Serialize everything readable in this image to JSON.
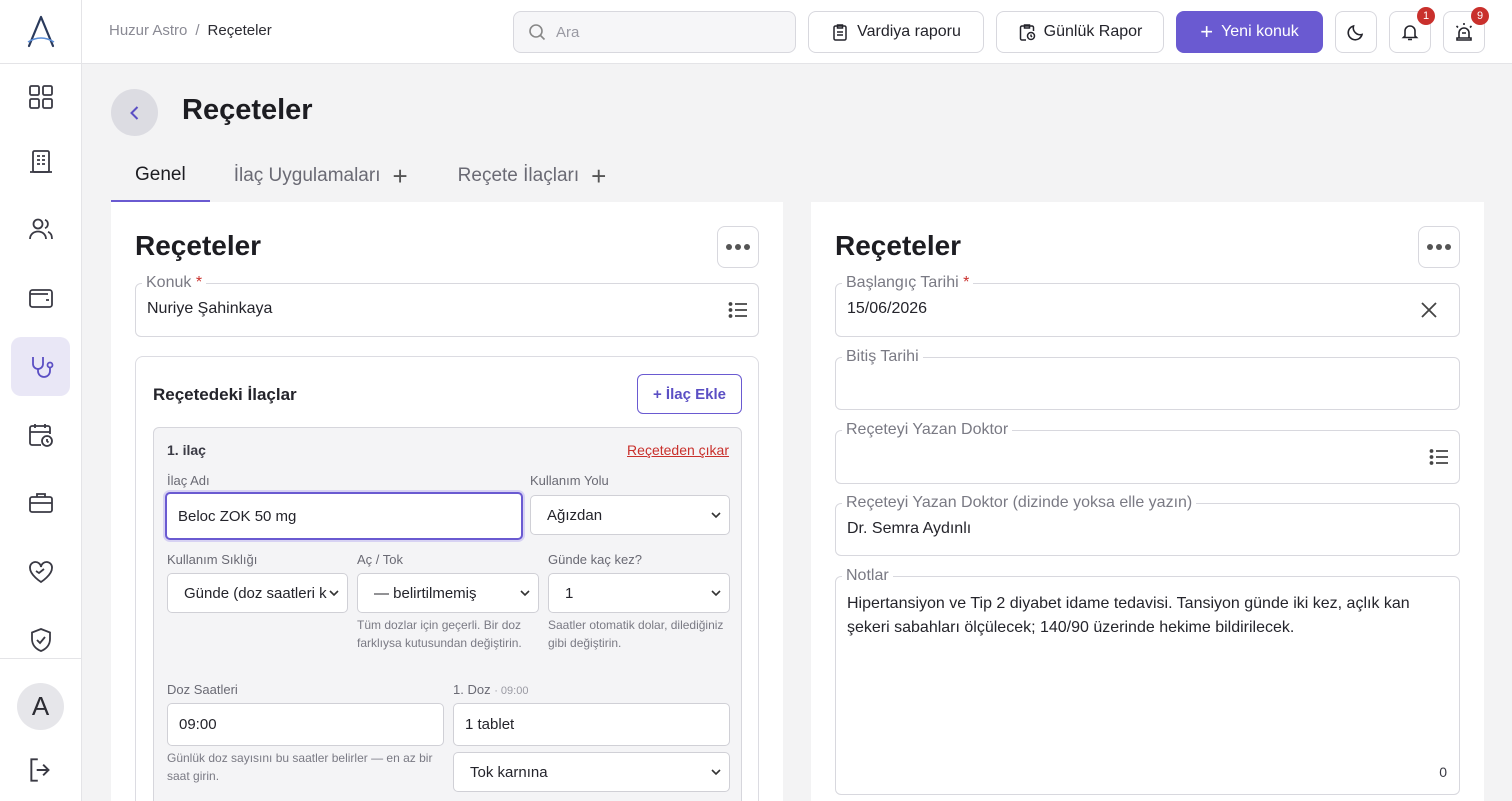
{
  "sidebar": {
    "logo_icon": "astro-logo-icon",
    "items": [
      {
        "name": "dashboard",
        "icon": "grid-icon"
      },
      {
        "name": "reports",
        "icon": "building-icon"
      },
      {
        "name": "guests",
        "icon": "users-icon"
      },
      {
        "name": "wallet",
        "icon": "wallet-icon"
      },
      {
        "name": "health",
        "icon": "stethoscope-icon",
        "active": true
      },
      {
        "name": "calendar",
        "icon": "calendar-clock-icon"
      },
      {
        "name": "staff",
        "icon": "briefcase-icon"
      },
      {
        "name": "care",
        "icon": "heart-hand-icon"
      },
      {
        "name": "security",
        "icon": "shield-check-icon"
      }
    ],
    "avatar_initial": "A"
  },
  "topbar": {
    "breadcrumb_root": "Huzur Astro",
    "breadcrumb_sep": "/",
    "breadcrumb_current": "Reçeteler",
    "search_placeholder": "Ara",
    "shift_report": "Vardiya raporu",
    "daily_report": "Günlük Rapor",
    "new_guest": "Yeni konuk",
    "notifications_count": "1",
    "alarm_count": "9"
  },
  "page": {
    "title": "Reçeteler",
    "tabs": [
      {
        "label": "Genel"
      },
      {
        "label": "İlaç Uygulamaları"
      },
      {
        "label": "Reçete İlaçları"
      }
    ]
  },
  "left_card": {
    "title": "Reçeteler",
    "guest_label": "Konuk",
    "required_mark": "*",
    "guest_value": "Nuriye Şahinkaya",
    "meds_title": "Reçetedeki İlaçlar",
    "add_med": "+ İlaç Ekle",
    "med": {
      "title": "1. ilaç",
      "remove": "Reçeteden çıkar",
      "name_label": "İlaç Adı",
      "name_value": "Beloc ZOK 50 mg",
      "route_label": "Kullanım Yolu",
      "route_value": "Ağızdan",
      "freq_label": "Kullanım Sıklığı",
      "freq_value": "Günde (doz saatleri k",
      "meal_label": "Aç / Tok",
      "meal_value": "— belirtilmemiş",
      "meal_help": "Tüm dozlar için geçerli. Bir doz farklıysa kutusundan değiştirin.",
      "times_label": "Günde kaç kez?",
      "times_value": "1",
      "times_help": "Saatler otomatik dolar, dilediğiniz gibi değiştirin.",
      "dose_hours_label": "Doz Saatleri",
      "dose_hours_value": "09:00",
      "dose_hours_help": "Günlük doz sayısını bu saatler belirler — en az bir saat girin.",
      "dose1_label": "1. Doz",
      "dose1_time": "· 09:00",
      "dose1_amount": "1 tablet",
      "dose1_meal": "Tok karnına"
    }
  },
  "right_card": {
    "title": "Reçeteler",
    "start_label": "Başlangıç Tarihi",
    "required_mark": "*",
    "start_value": "15/06/2026",
    "end_label": "Bitiş Tarihi",
    "doctor_label": "Reçeteyi Yazan Doktor",
    "doctor_manual_label": "Reçeteyi Yazan Doktor (dizinde yoksa elle yazın)",
    "doctor_manual_value": "Dr. Semra Aydınlı",
    "notes_label": "Notlar",
    "notes_value": "Hipertansiyon ve Tip 2 diyabet idame tedavisi. Tansiyon günde iki kez, açlık kan şekeri sabahları ölçülecek; 140/90 üzerinde hekime bildirilecek.",
    "notes_counter": "0"
  }
}
